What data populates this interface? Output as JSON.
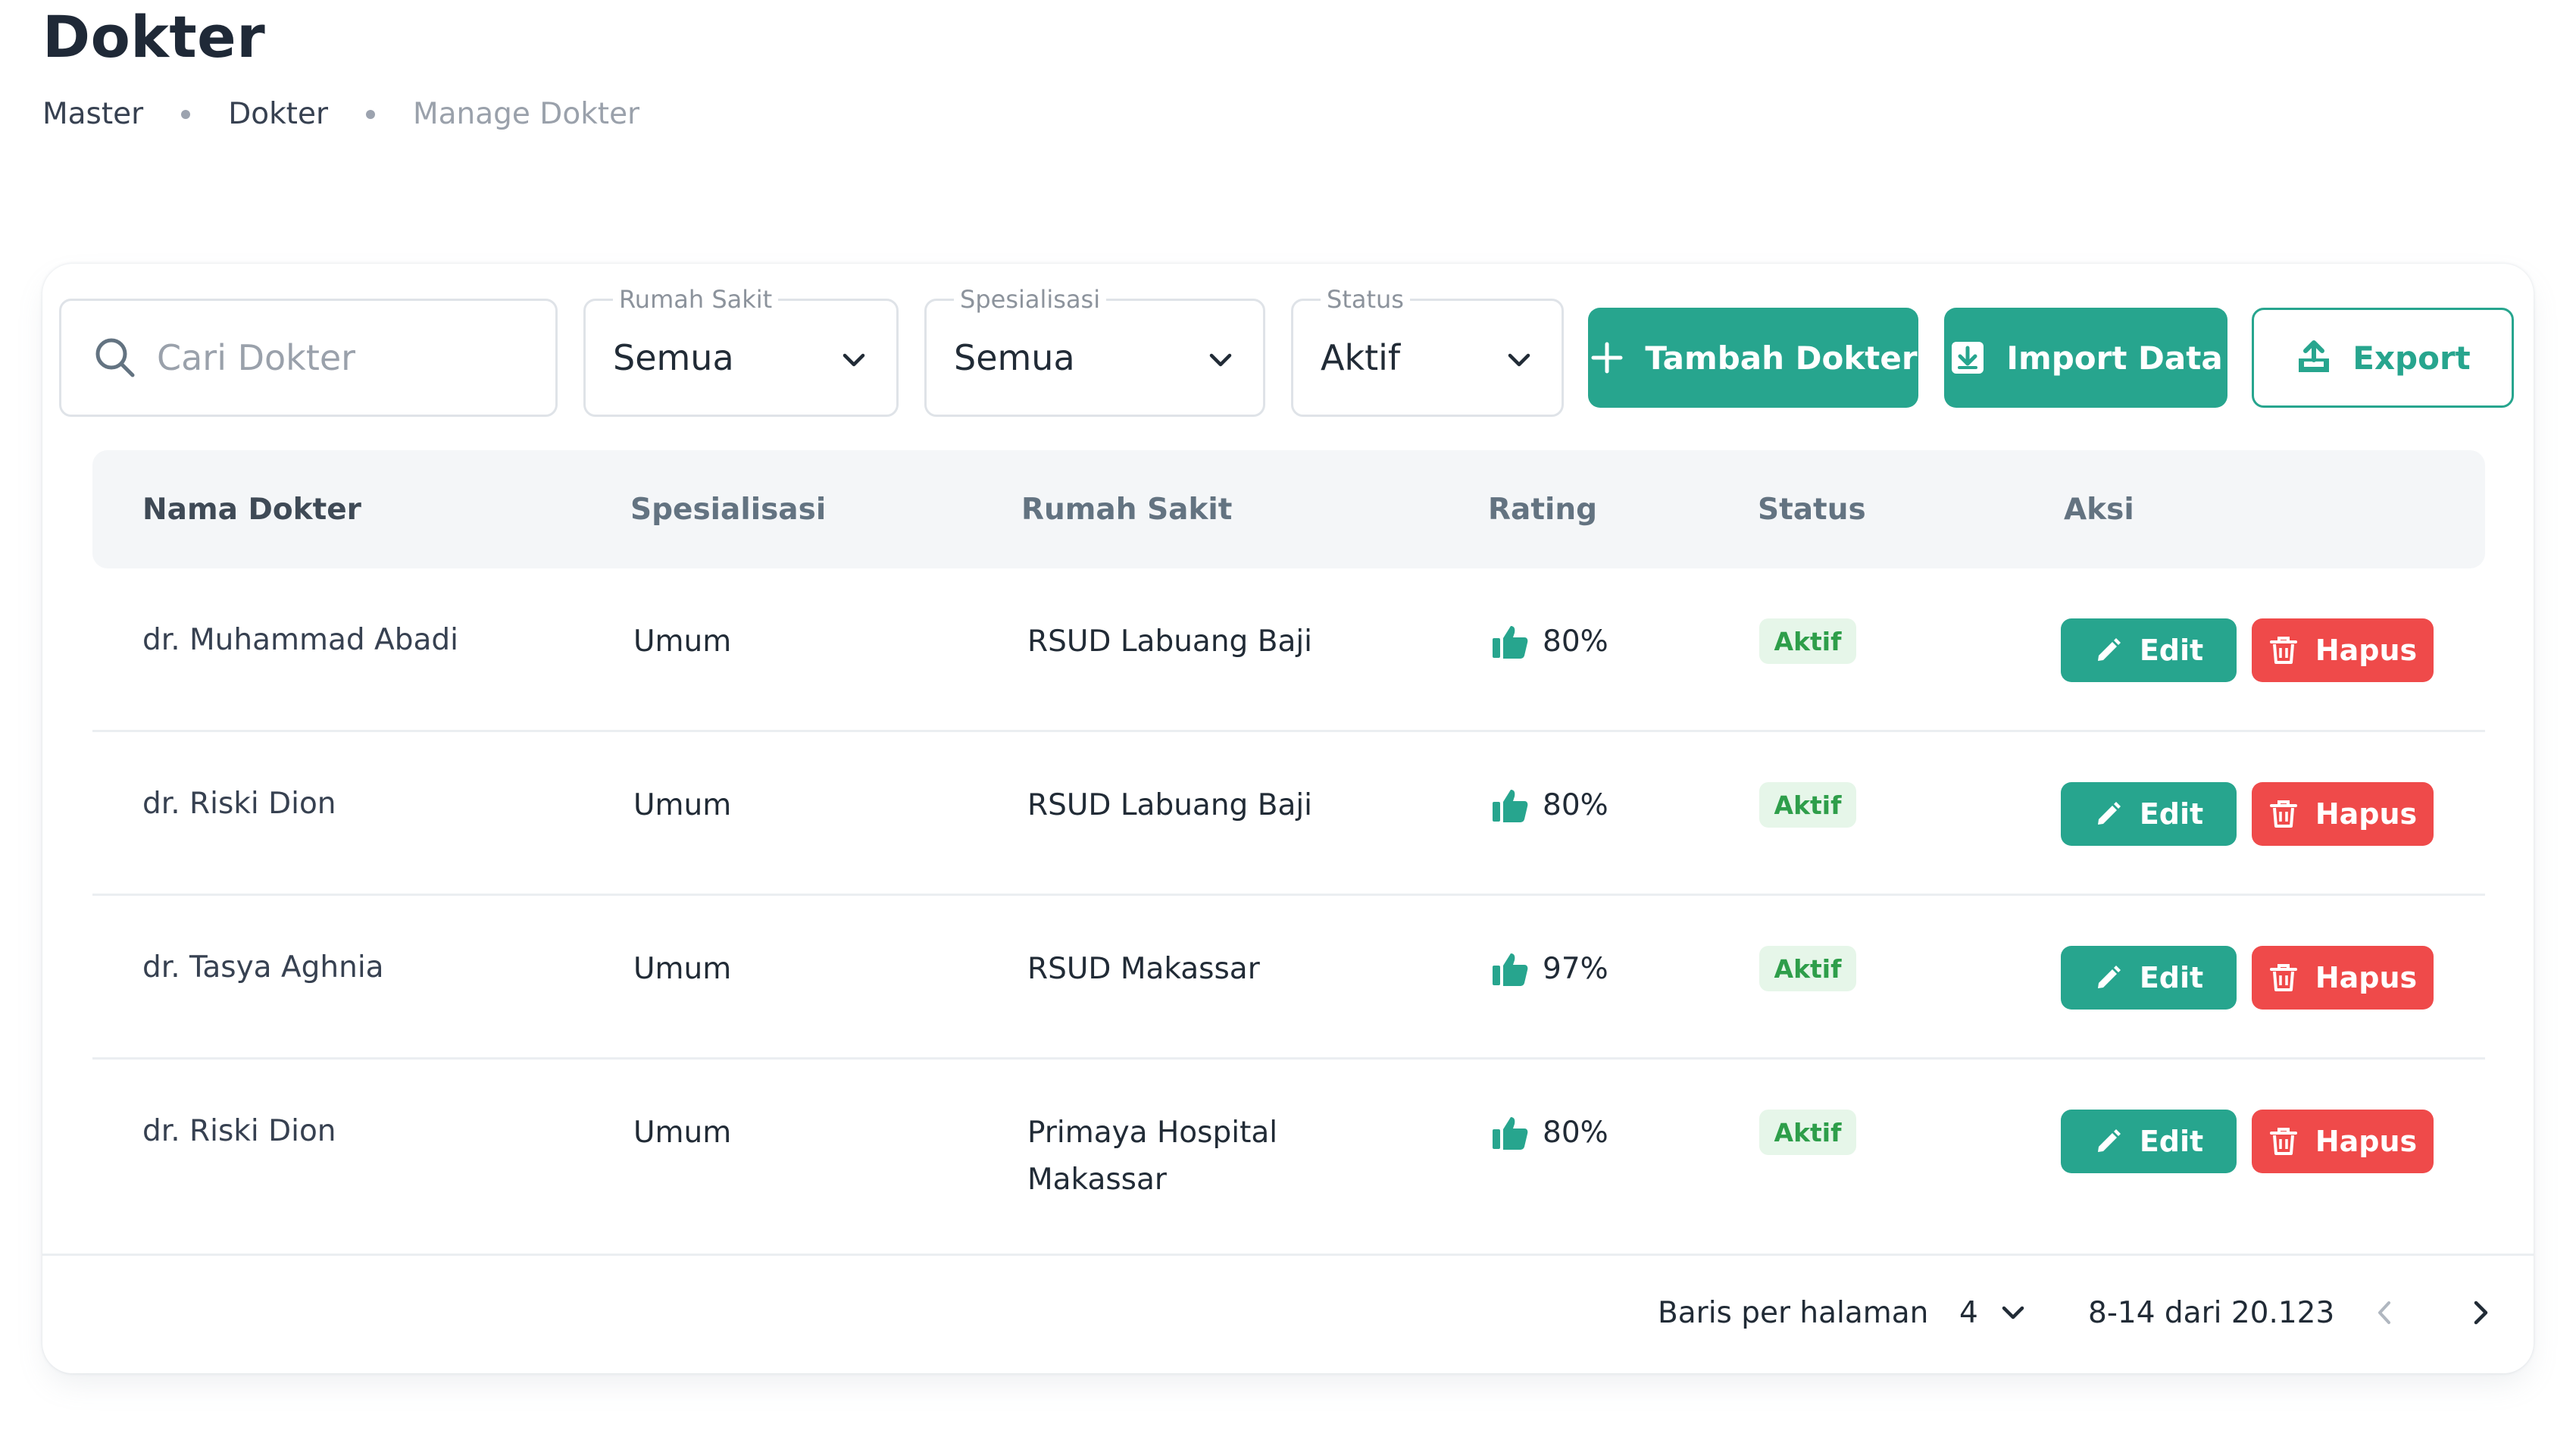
{
  "page": {
    "title": "Dokter",
    "breadcrumb": [
      "Master",
      "Dokter",
      "Manage Dokter"
    ]
  },
  "toolbar": {
    "search_placeholder": "Cari Dokter",
    "filters": {
      "rumah_sakit": {
        "label": "Rumah Sakit",
        "value": "Semua"
      },
      "spesialisasi": {
        "label": "Spesialisasi",
        "value": "Semua"
      },
      "status": {
        "label": "Status",
        "value": "Aktif"
      }
    },
    "add_label": "Tambah Dokter",
    "import_label": "Import Data",
    "export_label": "Export"
  },
  "table": {
    "columns": [
      "Nama Dokter",
      "Spesialisasi",
      "Rumah Sakit",
      "Rating",
      "Status",
      "Aksi"
    ],
    "rows": [
      {
        "name": "dr. Muhammad Abadi",
        "specialization": "Umum",
        "hospital": [
          "RSUD Labuang Baji"
        ],
        "rating": "80%",
        "status": "Aktif"
      },
      {
        "name": "dr. Riski Dion",
        "specialization": "Umum",
        "hospital": [
          "RSUD Labuang Baji"
        ],
        "rating": "80%",
        "status": "Aktif"
      },
      {
        "name": "dr. Tasya Aghnia",
        "specialization": "Umum",
        "hospital": [
          "RSUD Makassar"
        ],
        "rating": "97%",
        "status": "Aktif"
      },
      {
        "name": "dr. Riski Dion",
        "specialization": "Umum",
        "hospital": [
          "Primaya Hospital",
          "Makassar"
        ],
        "rating": "80%",
        "status": "Aktif"
      }
    ],
    "edit_label": "Edit",
    "delete_label": "Hapus"
  },
  "pagination": {
    "rows_per_page_label": "Baris per halaman",
    "rows_per_page": "4",
    "range": "8-14 dari 20.123"
  },
  "colors": {
    "primary": "#27a58e",
    "danger": "#ef4a4a",
    "status_active_bg": "#e6f6e9",
    "status_active_text": "#2e9e4a"
  },
  "icons": {
    "search": "search-icon",
    "dropdown": "chevron-down-icon",
    "add": "plus-icon",
    "import": "import-icon",
    "export": "upload-icon",
    "rating": "thumbs-up-icon",
    "edit": "pencil-icon",
    "delete": "trash-icon",
    "prev": "chevron-left-icon",
    "next": "chevron-right-icon"
  }
}
